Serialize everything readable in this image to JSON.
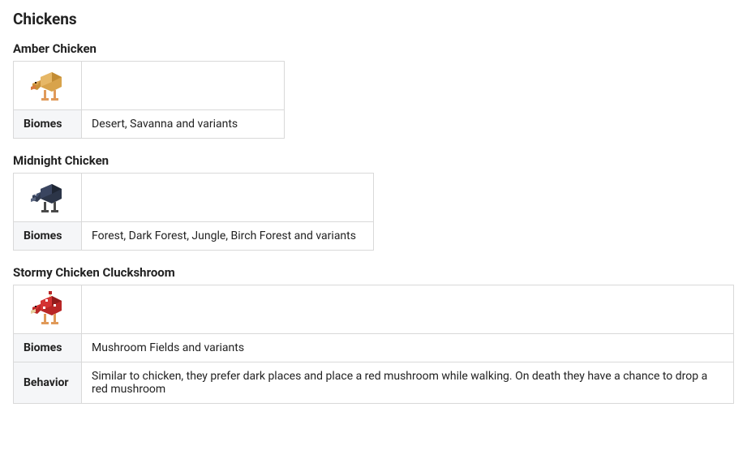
{
  "page": {
    "heading": "Chickens"
  },
  "labels": {
    "biomes": "Biomes",
    "behavior": "Behavior"
  },
  "entries": [
    {
      "name": "Amber Chicken",
      "icon": "amber-chicken-icon",
      "biomes": "Desert, Savanna and variants"
    },
    {
      "name": "Midnight Chicken",
      "icon": "midnight-chicken-icon",
      "biomes": "Forest, Dark Forest, Jungle, Birch Forest and variants"
    },
    {
      "name": "Stormy Chicken Cluckshroom",
      "icon": "cluckshroom-icon",
      "biomes": "Mushroom Fields and variants",
      "behavior": "Similar to chicken, they prefer dark places and place a red mushroom while walking. On death they have a chance to drop a red mushroom"
    }
  ]
}
